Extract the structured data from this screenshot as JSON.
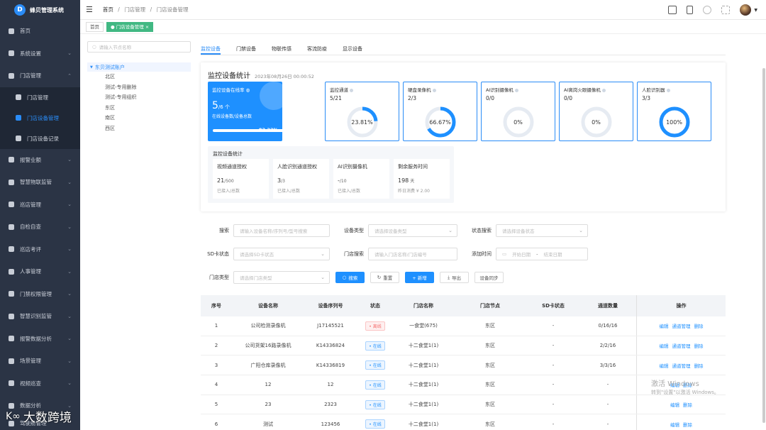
{
  "app": {
    "title": "蜂贝管理系统",
    "logo_letter": "D"
  },
  "sidebar": {
    "items": [
      {
        "label": "首页"
      },
      {
        "label": "系统设置"
      },
      {
        "label": "门店管理"
      },
      {
        "label": "门店管理"
      },
      {
        "label": "门店设备管理"
      },
      {
        "label": "门店设备记录"
      },
      {
        "label": "报警业额"
      },
      {
        "label": "智慧物联监管"
      },
      {
        "label": "巡店管理"
      },
      {
        "label": "自检自查"
      },
      {
        "label": "巡店考评"
      },
      {
        "label": "人事管理"
      },
      {
        "label": "门禁权限管理"
      },
      {
        "label": "智慧识别监管"
      },
      {
        "label": "报警数据分析"
      },
      {
        "label": "场景管理"
      },
      {
        "label": "视频巡查"
      },
      {
        "label": "数据分析"
      },
      {
        "label": "驾驶舱管理"
      }
    ]
  },
  "breadcrumb": {
    "home": "首页",
    "sep": "/",
    "level1": "门店管理",
    "level2": "门店设备管理"
  },
  "tags": {
    "home": "首页",
    "current": "● 门店设备管理 ×"
  },
  "tree": {
    "search_placeholder": "请输入节点名称",
    "root": "东贝测试账户",
    "nodes": [
      "北区",
      "测试-专用删除",
      "测试-专用组织",
      "东区",
      "南区",
      "西区"
    ]
  },
  "tabs": [
    "监控设备",
    "门禁设备",
    "物联传感",
    "客流防疫",
    "显示设备"
  ],
  "stats": {
    "title": "监控设备统计",
    "date": "2023年08月26日 00:00:52",
    "online": {
      "label": "监控设备在线率",
      "value": "5",
      "unit": "/6 个",
      "desc": "在线设备数/设备总数",
      "percent": "83.33%",
      "fill": 0.8333
    },
    "cards": [
      {
        "label": "监控通道",
        "value": "5/21",
        "percent": "23.81%",
        "fill": 0.2381
      },
      {
        "label": "硬盘录像机",
        "value": "2/3",
        "percent": "66.67%",
        "fill": 0.6667
      },
      {
        "label": "AI识别摄像机",
        "value": "0/0",
        "percent": "0%",
        "fill": 0
      },
      {
        "label": "AI离岗火眼摄像机",
        "value": "0/0",
        "percent": "0%",
        "fill": 0
      },
      {
        "label": "人脸识别器",
        "value": "3/3",
        "percent": "100%",
        "fill": 1
      }
    ],
    "sub_title": "监控设备统计",
    "sub": [
      {
        "label": "视频通道授权",
        "value": "21",
        "unit": "/500",
        "desc": "已接入/总数"
      },
      {
        "label": "人脸识别通道授权",
        "value": "3",
        "unit": "/3",
        "desc": "已接入/总数"
      },
      {
        "label": "AI识别摄像机",
        "value": "-",
        "unit": "/10",
        "desc": "已接入/总数"
      },
      {
        "label": "剩余服务时间",
        "value": "198",
        "unit": " 天",
        "desc": "昨日消费 ¥ 2.00"
      }
    ]
  },
  "filters": {
    "search_label": "搜索",
    "search_placeholder": "请输入设备名称/序列号/型号搜索",
    "type_label": "设备类型",
    "type_placeholder": "请选择设备类型",
    "status_label": "状态搜索",
    "status_placeholder": "请选择设备状态",
    "sd_label": "SD卡状态",
    "sd_placeholder": "请选择SD卡状态",
    "store_label": "门店搜索",
    "store_placeholder": "请输入门店名称/门店编号",
    "time_label": "添加时间",
    "time_start": "开始日期",
    "time_sep": "-",
    "time_end": "结束日期",
    "storetype_label": "门店类型",
    "storetype_placeholder": "请选择门店类型",
    "btn_search": "搜索",
    "btn_reset": "重置",
    "btn_add": "+ 新增",
    "btn_export": "导出",
    "btn_sync": "设备同步"
  },
  "table": {
    "headers": [
      "序号",
      "设备名称",
      "设备序列号",
      "状态",
      "门店名称",
      "门店节点",
      "SD卡状态",
      "通道数量",
      "操作"
    ],
    "rows": [
      {
        "no": "1",
        "name": "公司检测录像机",
        "sn": "J17145521",
        "status": "离线",
        "status_type": "off",
        "store": "一食堂(675)",
        "node": "东区",
        "sd": "-",
        "ch": "0/16/16",
        "ops": [
          "编辑",
          "通道管理",
          "删除"
        ]
      },
      {
        "no": "2",
        "name": "公司货架16路录像机",
        "sn": "K14336824",
        "status": "在线",
        "status_type": "on",
        "store": "十二食堂1(1)",
        "node": "东区",
        "sd": "-",
        "ch": "2/2/16",
        "ops": [
          "编辑",
          "通道管理",
          "删除"
        ]
      },
      {
        "no": "3",
        "name": "广阳仓库录像机",
        "sn": "K14336819",
        "status": "在线",
        "status_type": "on",
        "store": "十二食堂1(1)",
        "node": "东区",
        "sd": "-",
        "ch": "3/3/16",
        "ops": [
          "编辑",
          "通道管理",
          "删除"
        ]
      },
      {
        "no": "4",
        "name": "12",
        "sn": "12",
        "status": "在线",
        "status_type": "on",
        "store": "十二食堂1(1)",
        "node": "东区",
        "sd": "-",
        "ch": "-",
        "ops": [
          "编辑",
          "删除"
        ]
      },
      {
        "no": "5",
        "name": "23",
        "sn": "2323",
        "status": "在线",
        "status_type": "on",
        "store": "十二食堂1(1)",
        "node": "东区",
        "sd": "-",
        "ch": "-",
        "ops": [
          "编辑",
          "删除"
        ]
      },
      {
        "no": "6",
        "name": "测试",
        "sn": "123456",
        "status": "在线",
        "status_type": "on",
        "store": "十二食堂1(1)",
        "node": "东区",
        "sd": "-",
        "ch": "-",
        "ops": [
          "编辑",
          "删除"
        ]
      }
    ]
  },
  "overlay": {
    "win_title": "激活 Windows",
    "win_sub": "转到\"设置\"以激活 Windows。",
    "watermark": "大数跨境"
  },
  "colors": {
    "accent": "#1e90ff",
    "sidebar_bg": "#2b3445",
    "active_tag": "#41b883"
  }
}
